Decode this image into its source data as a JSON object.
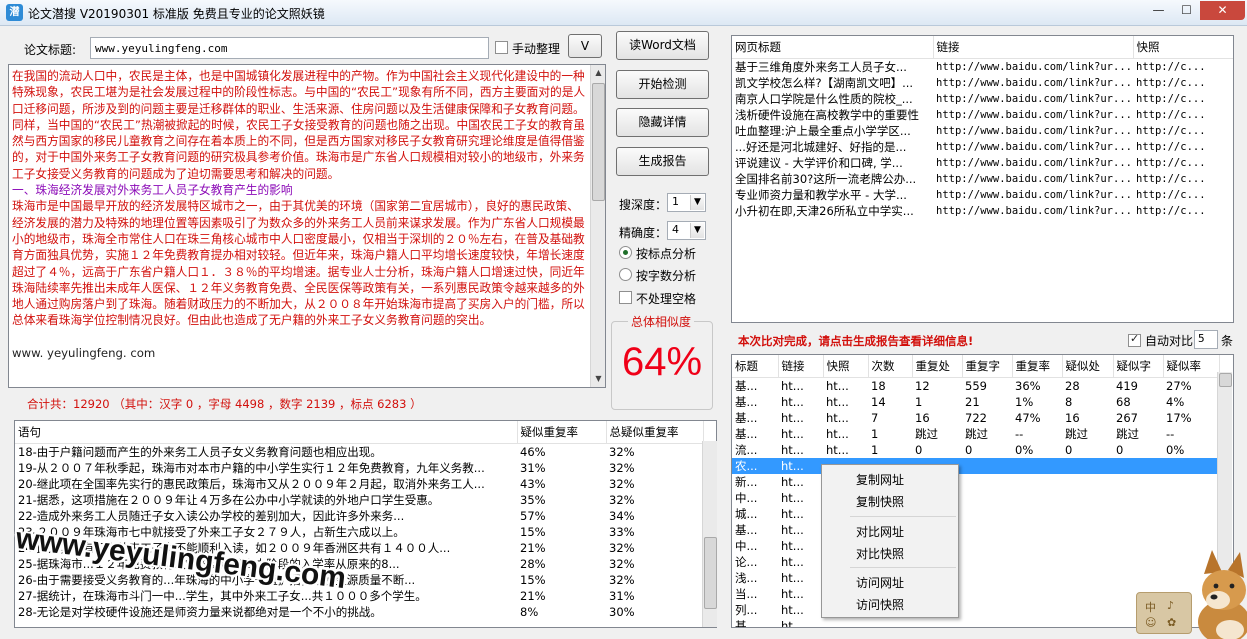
{
  "window": {
    "title": "论文潜搜 V20190301 标准版 免费且专业的论文照妖镜"
  },
  "top": {
    "title_label": "论文标题:",
    "title_value": "www.yeyulingfeng.com",
    "manual_label": "手动整理",
    "dropdown_btn": "V"
  },
  "article": {
    "p1": "在我国的流动人口中，农民是主体，也是中国城镇化发展进程中的产物。作为中国社会主义现代化建设中的一种特殊现象，农民工堪为是社会发展过程中的阶段性标志。与中国的“农民工”现象有所不同，西方主要面对的是人口迁移问题，所涉及到的问题主要是迁移群体的职业、生活来源、住房问题以及生活健康保障和子女教育问题。同样，当中国的“农民工”热潮被掀起的时候，农民工子女接受教育的问题也随之出现。中国农民工子女的教育虽然与西方国家的移民儿童教育之间存在着本质上的不同，但是西方国家对移民子女教育研究理论维度是值得借鉴的，对于中国外来务工子女教育问题的研究极具参考价值。珠海市是广东省人口规模相对较小的地级市，外来务工子女接受义务教育的问题成为了迫切需要思考和解决的问题。",
    "p2": "一、珠海经济发展对外来务工人员子女教育产生的影响",
    "p3": "珠海市是中国最早开放的经济发展特区城市之一，由于其优美的环境（国家第二宜居城市），良好的惠民政策、经济发展的潜力及特殊的地理位置等因素吸引了为数众多的外来务工人员前来谋求发展。作为广东省人口规模最小的地级市，珠海全市常住人口在珠三角核心城市中人口密度最小，仅相当于深圳的２０％左右，在普及基础教育方面独具优势，实施１２年免费教育提办相对较轻。但近年来，珠海户籍人口平均增长速度较快，年增长速度超过了４％，远高于广东省户籍人口１．３８％的平均增速。据专业人士分析，珠海户籍人口增速过快，同近年珠海陆续率先推出未成年人医保、１２年义务教育免费、全民医保等政策有关，一系列惠民政策令越来越多的外地人通过购房落户到了珠海。随着财政压力的不断加大，从２００８年开始珠海市提高了买房入户的门槛，所以总体来看珠海学位控制情况良好。但由此也造成了无户籍的外来工子女义务教育问题的突出。",
    "p4": "www. yeyulingfeng. com"
  },
  "stats": {
    "text": "合计共：12920 （其中：汉字 0 ，字母 4498 ，数字 2139 ，标点 6283 ）"
  },
  "buttons": {
    "read_word": "读Word文档",
    "start_check": "开始检测",
    "hide_detail": "隐藏详情",
    "gen_report": "生成报告"
  },
  "options": {
    "depth_label": "搜深度：",
    "depth_value": "1",
    "precision_label": "精确度：",
    "precision_value": "4",
    "by_punct": "按标点分析",
    "by_char": "按字数分析",
    "no_space": "不处理空格"
  },
  "similarity": {
    "label": "总体相似度",
    "value": "64%"
  },
  "sentences": {
    "headers": [
      "语句",
      "疑似重复率",
      "总疑似重复率"
    ],
    "rows": [
      [
        "18-由于户籍问题而产生的外来务工人员子女义务教育问题也相应出现。",
        "46%",
        "32%"
      ],
      [
        "19-从２００７年秋季起，珠海市对本市户籍的中小学生实行１２年免费教育，九年义务教...",
        "31%",
        "32%"
      ],
      [
        "20-继此项在全国率先实行的惠民政策后，珠海市又从２００９年２月起，取消外来务工人...",
        "43%",
        "32%"
      ],
      [
        "21-据悉，这项措施在２００９年让４万多在公办中小学就读的外地户口学生受惠。",
        "35%",
        "32%"
      ],
      [
        "22-造成外来务工人员随迁子女入读公办学校的差别加大，因此许多外来务...",
        "57%",
        "34%"
      ],
      [
        "23-２００９年珠海市七中就接受了外来工子女２７９人，占新生六成以上。",
        "15%",
        "33%"
      ],
      [
        "24-此外，还有不少外来工子女不能顺利入读，如２００９年香洲区共有１４００人...",
        "21%",
        "32%"
      ],
      [
        "25-据珠海市...１２年免费教育政策的实施使高中阶段的入学率从原来的8...",
        "28%",
        "32%"
      ],
      [
        "26-由于需要接受义务教育的...年珠海的中小学一直扩招，致使生源质量不断...",
        "15%",
        "32%"
      ],
      [
        "27-据统计，在珠海市斗门一中...学生，其中外来工子女...共１０００多个学生。",
        "21%",
        "31%"
      ],
      [
        "28-无论是对学校硬件设施还是师资力量来说都绝对是一个不小的挑战。",
        "8%",
        "30%"
      ]
    ]
  },
  "webpages": {
    "headers": [
      "网页标题",
      "链接",
      "快照"
    ],
    "rows": [
      [
        "基于三维角度外来务工人员子女...",
        "http://www.baidu.com/link?ur...",
        "http://c..."
      ],
      [
        "凯文学校怎么样?【湖南凯文吧】...",
        "http://www.baidu.com/link?ur...",
        "http://c..."
      ],
      [
        "南京人口学院是什么性质的院校_...",
        "http://www.baidu.com/link?ur...",
        "http://c..."
      ],
      [
        "浅析硬件设施在高校教学中的重要性",
        "http://www.baidu.com/link?ur...",
        "http://c..."
      ],
      [
        "吐血整理:沪上最全重点小学学区...",
        "http://www.baidu.com/link?ur...",
        "http://c..."
      ],
      [
        "...好还是河北城建好、好指的是...",
        "http://www.baidu.com/link?ur...",
        "http://c..."
      ],
      [
        "评说建议 - 大学评价和口碑, 学...",
        "http://www.baidu.com/link?ur...",
        "http://c..."
      ],
      [
        "全国排名前30?这所一流老牌公办...",
        "http://www.baidu.com/link?ur...",
        "http://c..."
      ],
      [
        "专业师资力量和教学水平 - 大学...",
        "http://www.baidu.com/link?ur...",
        "http://c..."
      ],
      [
        "小升初在即,天津26所私立中学实...",
        "http://www.baidu.com/link?ur...",
        "http://c..."
      ]
    ]
  },
  "status": {
    "message": "本次比对完成，请点击生成报告查看详细信息!",
    "auto_compare_label": "自动对比",
    "auto_compare_value": "5",
    "unit": "条"
  },
  "results": {
    "headers": [
      "标题",
      "链接",
      "快照",
      "次数",
      "重复处",
      "重复字",
      "重复率",
      "疑似处",
      "疑似字",
      "疑似率"
    ],
    "rows": [
      [
        "基...",
        "ht...",
        "ht...",
        "18",
        "12",
        "559",
        "36%",
        "28",
        "419",
        "27%"
      ],
      [
        "基...",
        "ht...",
        "ht...",
        "14",
        "1",
        "21",
        "1%",
        "8",
        "68",
        "4%"
      ],
      [
        "基...",
        "ht...",
        "ht...",
        "7",
        "16",
        "722",
        "47%",
        "16",
        "267",
        "17%"
      ],
      [
        "基...",
        "ht...",
        "ht...",
        "1",
        "跳过",
        "跳过",
        "--",
        "跳过",
        "跳过",
        "--"
      ],
      [
        "流...",
        "ht...",
        "ht...",
        "1",
        "0",
        "0",
        "0%",
        "0",
        "0",
        "0%"
      ],
      [
        "农...",
        "ht...",
        "",
        "",
        "",
        "",
        "",
        "",
        "",
        ""
      ],
      [
        "新...",
        "ht...",
        "",
        "",
        "",
        "",
        "",
        "",
        "",
        ""
      ],
      [
        "中...",
        "ht...",
        "",
        "",
        "",
        "",
        "",
        "",
        "",
        ""
      ],
      [
        "城...",
        "ht...",
        "",
        "",
        "",
        "",
        "",
        "",
        "",
        ""
      ],
      [
        "基...",
        "ht...",
        "",
        "",
        "",
        "",
        "",
        "",
        "",
        ""
      ],
      [
        "中...",
        "ht...",
        "",
        "",
        "",
        "",
        "",
        "",
        "",
        ""
      ],
      [
        "论...",
        "ht...",
        "",
        "",
        "",
        "",
        "",
        "",
        "",
        ""
      ],
      [
        "浅...",
        "ht...",
        "",
        "",
        "",
        "",
        "",
        "",
        "",
        ""
      ],
      [
        "当...",
        "ht...",
        "",
        "",
        "",
        "",
        "",
        "",
        "",
        ""
      ],
      [
        "列...",
        "ht...",
        "",
        "",
        "",
        "",
        "",
        "",
        "",
        ""
      ],
      [
        "基...",
        "ht...",
        "",
        "",
        "",
        "",
        "",
        "",
        "",
        ""
      ]
    ]
  },
  "context_menu": {
    "copy_url": "复制网址",
    "copy_snapshot": "复制快照",
    "compare_url": "对比网址",
    "compare_snapshot": "对比快照",
    "visit_url": "访问网址",
    "visit_snapshot": "访问快照"
  },
  "watermark": "www.yeyulingfeng.com",
  "toolbox": {
    "t1": "中",
    "t2": "♪",
    "t3": "☺",
    "t4": "✿"
  },
  "colors": {
    "accent_red": "#d2100c",
    "purple_text": "#8b0ab7",
    "selection": "#3399ff",
    "similarity": "#f00018"
  }
}
